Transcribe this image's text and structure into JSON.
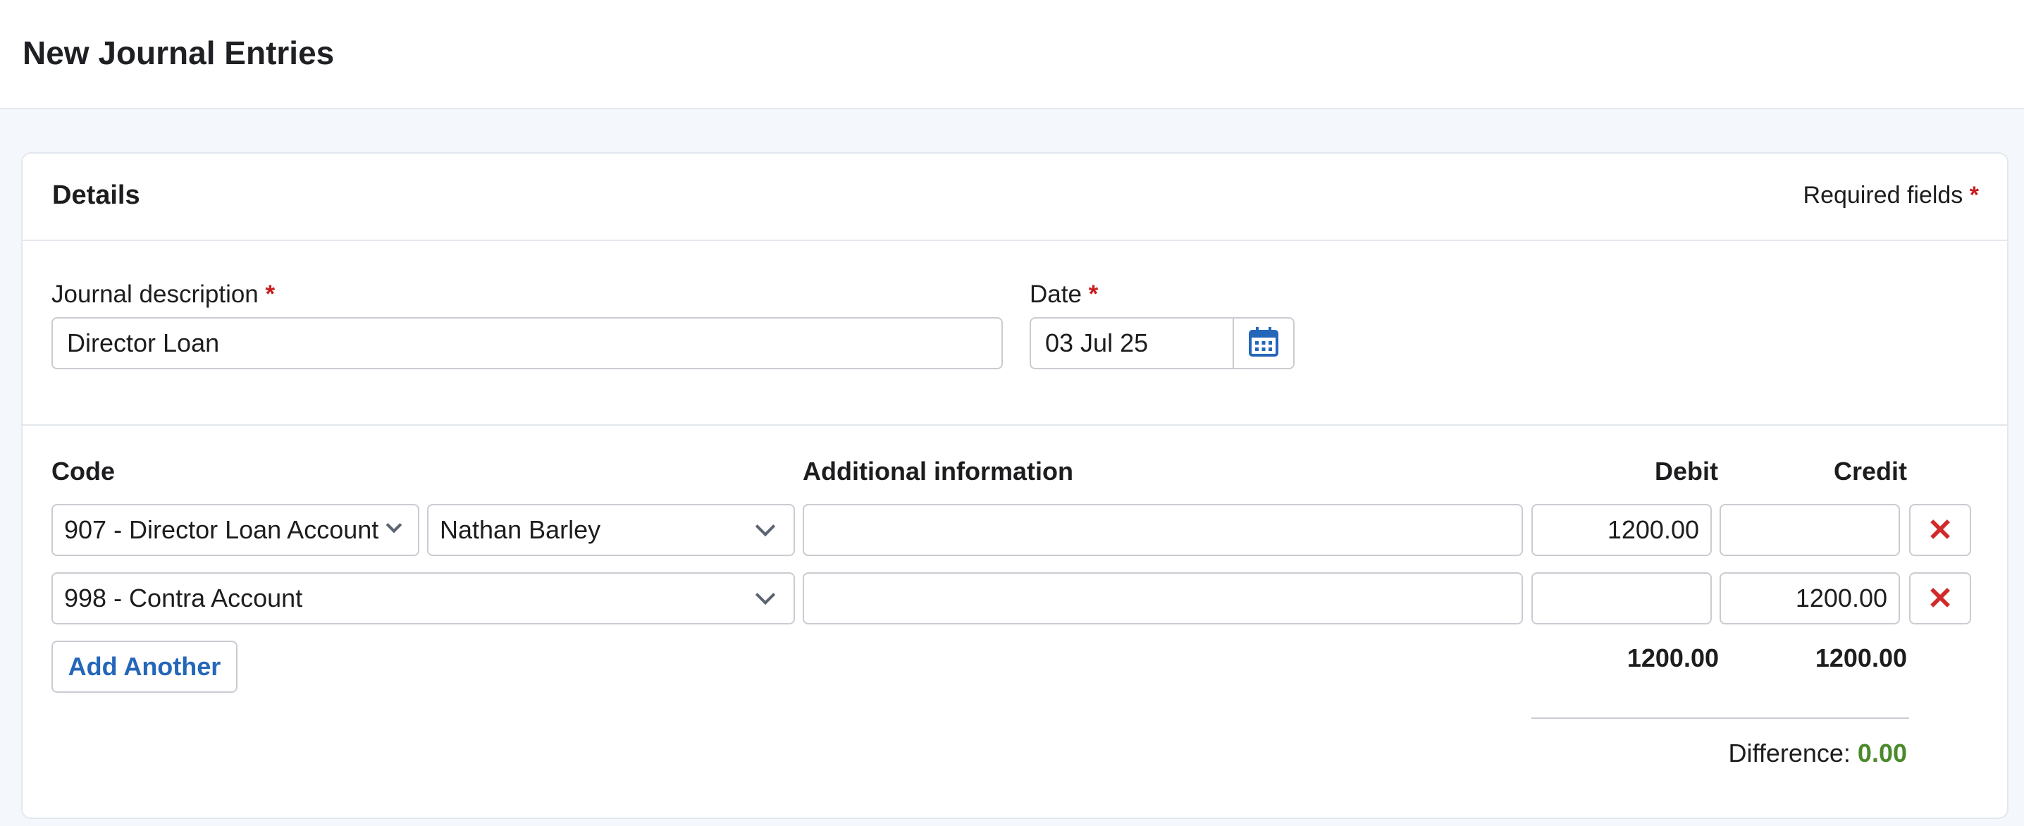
{
  "page": {
    "title": "New Journal Entries"
  },
  "details": {
    "title": "Details",
    "required_note": "Required fields",
    "required_star": "*"
  },
  "form": {
    "description_label": "Journal description",
    "description_value": "Director Loan",
    "date_label": "Date",
    "date_value": "03 Jul 25"
  },
  "table": {
    "headers": {
      "code": "Code",
      "additional": "Additional information",
      "debit": "Debit",
      "credit": "Credit"
    },
    "rows": [
      {
        "code": "907 - Director Loan Account",
        "sub": "Nathan Barley",
        "additional": "",
        "debit": "1200.00",
        "credit": ""
      },
      {
        "code": "998 - Contra Account",
        "additional": "",
        "debit": "",
        "credit": "1200.00"
      }
    ],
    "add_label": "Add Another",
    "totals": {
      "debit": "1200.00",
      "credit": "1200.00"
    },
    "difference_label": "Difference:",
    "difference_value": "0.00"
  },
  "icons": {
    "calendar": "calendar-icon",
    "chevron": "chevron-down-icon",
    "delete": "close-icon"
  },
  "colors": {
    "required": "#c81e1e",
    "accent": "#2466b8",
    "delete": "#d12a2a",
    "difference": "#4a8a2a"
  }
}
